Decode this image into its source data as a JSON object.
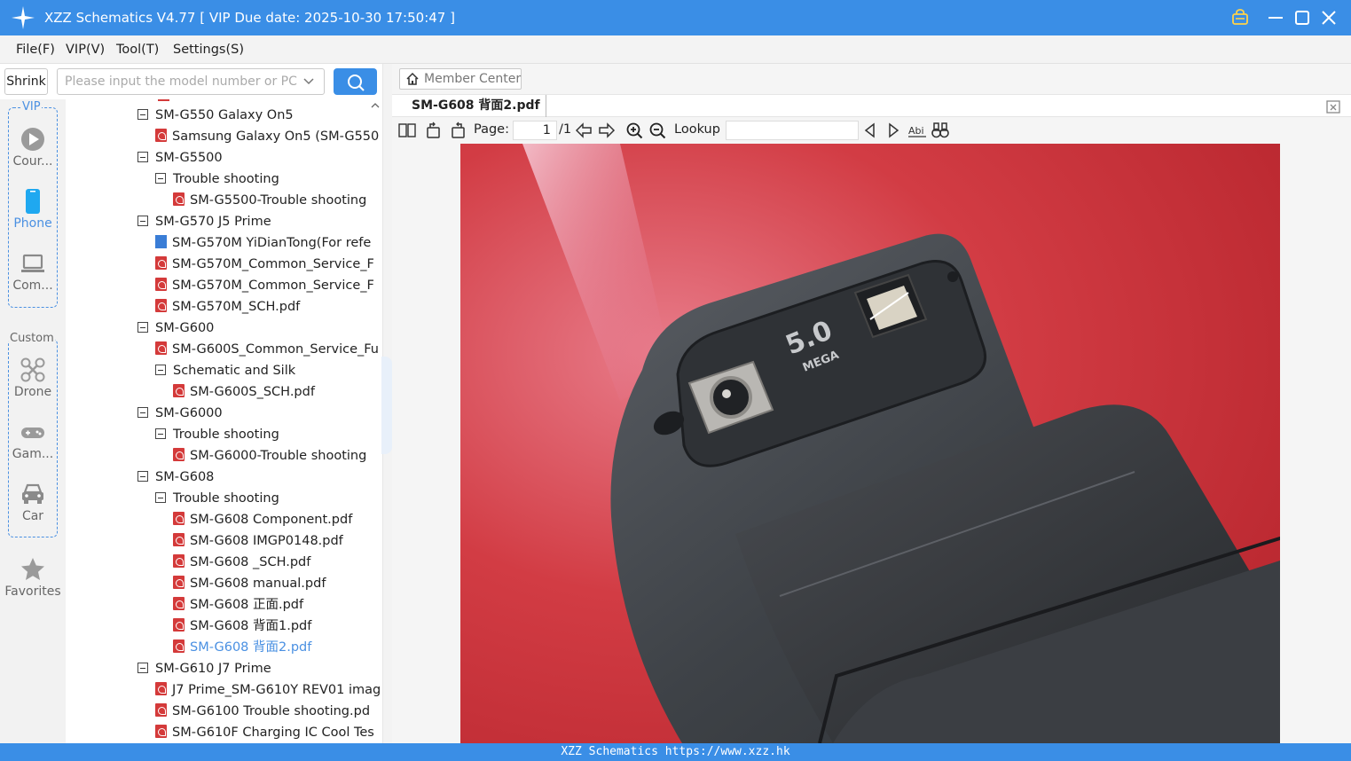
{
  "window": {
    "title": "XZZ Schematics V4.77 [ VIP Due date: 2025-10-30 17:50:47 ]"
  },
  "menu": [
    "File(F)",
    "VIP(V)",
    "Tool(T)",
    "Settings(S)"
  ],
  "search": {
    "shrink_label": "Shrink",
    "placeholder": "Please input the model number or PCB"
  },
  "sidebar": {
    "vip_group_label": "VIP",
    "vip_items": [
      {
        "label": "Cour...",
        "icon": "play-circle-icon"
      },
      {
        "label": "Phone",
        "icon": "phone-icon",
        "active": true
      },
      {
        "label": "Com...",
        "icon": "laptop-icon"
      }
    ],
    "custom_group_label": "Custom",
    "custom_items": [
      {
        "label": "Drone",
        "icon": "drone-icon"
      },
      {
        "label": "Gam...",
        "icon": "gamepad-icon"
      },
      {
        "label": "Car",
        "icon": "car-icon"
      }
    ],
    "favorites_label": "Favorites"
  },
  "tree": [
    {
      "label": "SM-G550 Galaxy On5",
      "type": "folder",
      "level": 0
    },
    {
      "label": "Samsung Galaxy On5 (SM-G550",
      "type": "pdf",
      "level": 1
    },
    {
      "label": "SM-G5500",
      "type": "folder",
      "level": 0
    },
    {
      "label": "Trouble shooting",
      "type": "folder",
      "level": 1
    },
    {
      "label": "SM-G5500-Trouble shooting",
      "type": "pdf",
      "level": 2
    },
    {
      "label": "SM-G570 J5 Prime",
      "type": "folder",
      "level": 0
    },
    {
      "label": "SM-G570M YiDianTong(For refe",
      "type": "image",
      "level": 1
    },
    {
      "label": "SM-G570M_Common_Service_F",
      "type": "pdf",
      "level": 1
    },
    {
      "label": "SM-G570M_Common_Service_F",
      "type": "pdf",
      "level": 1
    },
    {
      "label": "SM-G570M_SCH.pdf",
      "type": "pdf",
      "level": 1
    },
    {
      "label": "SM-G600",
      "type": "folder",
      "level": 0
    },
    {
      "label": "SM-G600S_Common_Service_Fu",
      "type": "pdf",
      "level": 1
    },
    {
      "label": "Schematic and Silk",
      "type": "folder",
      "level": 1
    },
    {
      "label": "SM-G600S_SCH.pdf",
      "type": "pdf",
      "level": 2
    },
    {
      "label": "SM-G6000",
      "type": "folder",
      "level": 0
    },
    {
      "label": "Trouble shooting",
      "type": "folder",
      "level": 1
    },
    {
      "label": "SM-G6000-Trouble shooting",
      "type": "pdf",
      "level": 2
    },
    {
      "label": "SM-G608",
      "type": "folder",
      "level": 0
    },
    {
      "label": "Trouble shooting",
      "type": "folder",
      "level": 1
    },
    {
      "label": "SM-G608 Component.pdf",
      "type": "pdf",
      "level": 2
    },
    {
      "label": "SM-G608 IMGP0148.pdf",
      "type": "pdf",
      "level": 2
    },
    {
      "label": "SM-G608 _SCH.pdf",
      "type": "pdf",
      "level": 2
    },
    {
      "label": "SM-G608 manual.pdf",
      "type": "pdf",
      "level": 2
    },
    {
      "label": "SM-G608 正面.pdf",
      "type": "pdf",
      "level": 2
    },
    {
      "label": "SM-G608 背面1.pdf",
      "type": "pdf",
      "level": 2
    },
    {
      "label": "SM-G608 背面2.pdf",
      "type": "pdf",
      "level": 2,
      "selected": true
    },
    {
      "label": "SM-G610 J7 Prime",
      "type": "folder",
      "level": 0
    },
    {
      "label": "J7 Prime_SM-G610Y REV01 imag",
      "type": "pdf",
      "level": 1
    },
    {
      "label": "SM-G6100 Trouble shooting.pd",
      "type": "pdf",
      "level": 1
    },
    {
      "label": "SM-G610F Charging IC Cool Tes",
      "type": "pdf",
      "level": 1
    }
  ],
  "viewer": {
    "member_center": "Member Center",
    "tab_title": "SM-G608 背面2.pdf",
    "page_label": "Page:",
    "page_current": "1",
    "page_total": "/1",
    "lookup_label": "Lookup",
    "document_text": {
      "camera_badge_line1": "5.0",
      "camera_badge_line2": "MEGA"
    }
  },
  "status_bar": "XZZ Schematics https://www.xzz.hk",
  "colors": {
    "accent": "#3a8ee6",
    "pdf_icon": "#d43a3a",
    "selected_item": "#4a90e2"
  }
}
